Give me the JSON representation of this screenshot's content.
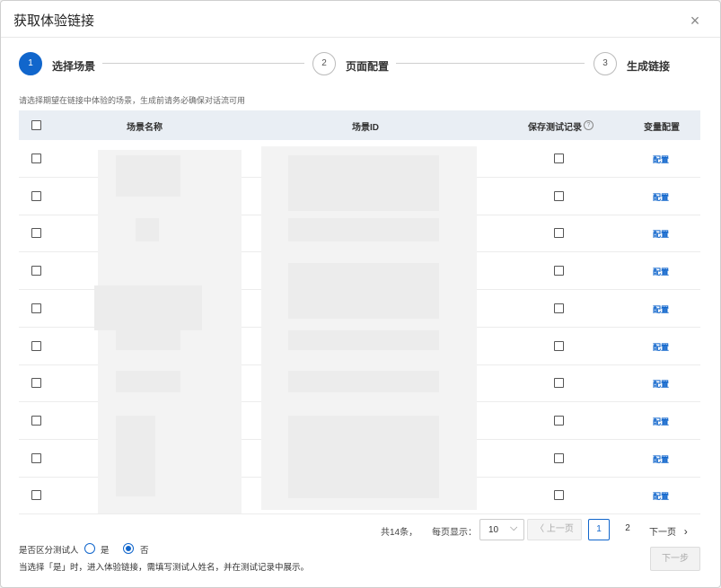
{
  "dialog": {
    "title": "获取体验链接",
    "close_icon": "×"
  },
  "steps": [
    {
      "number": "1",
      "label": "选择场景",
      "active": true
    },
    {
      "number": "2",
      "label": "页面配置",
      "active": false
    },
    {
      "number": "3",
      "label": "生成链接",
      "active": false
    }
  ],
  "hint": "请选择期望在链接中体验的场景，生成前请务必确保对话流可用",
  "table": {
    "columns": [
      "场景名称",
      "场景ID",
      "保存测试记录",
      "变量配置"
    ],
    "help_icon": "?",
    "row_action": "配置",
    "row_count": 10
  },
  "pagination": {
    "total": "共14条，",
    "per_page_label": "每页显示：",
    "per_page_value": "10",
    "per_page_arrow": "⌵",
    "prev": "〈 上一页",
    "pages": [
      "1",
      "2"
    ],
    "current_page": "1",
    "next": "下一页",
    "next_arrow": "›"
  },
  "tester": {
    "question": "是否区分测试人",
    "option_yes": "是",
    "option_no": "否",
    "selected": "否",
    "note": "当选择「是」时，进入体验链接，需填写测试人姓名，并在测试记录中展示。"
  },
  "footer": {
    "next_step": "下一步"
  }
}
